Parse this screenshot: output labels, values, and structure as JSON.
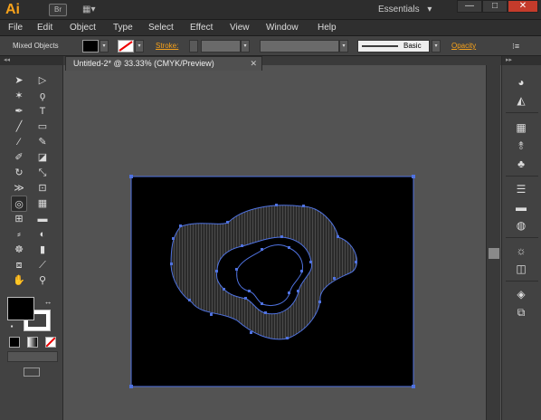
{
  "app": {
    "logo": "Ai",
    "bridge_label": "Br",
    "arrange_label": "▦▾",
    "workspace": "Essentials",
    "workspace_arrow": "▾",
    "window_controls": [
      "—",
      "□",
      "✕"
    ]
  },
  "menu": [
    "File",
    "Edit",
    "Object",
    "Type",
    "Select",
    "Effect",
    "View",
    "Window",
    "Help"
  ],
  "control_bar": {
    "selection": "Mixed Objects",
    "stroke_label": "Stroke:",
    "brush_label": "Basic",
    "opacity_label": "Opacity",
    "panel_menu": "⁝≡",
    "dropdown_arrow": "▾"
  },
  "document": {
    "tab_title": "Untitled-2* @ 33.33% (CMYK/Preview)",
    "close": "✕"
  },
  "tools": {
    "collapse": "◂◂",
    "icons": [
      "selection-icon",
      "direct-selection-icon",
      "magic-wand-icon",
      "lasso-icon",
      "pen-icon",
      "type-icon",
      "line-icon",
      "rectangle-icon",
      "paintbrush-icon",
      "pencil-icon",
      "blob-brush-icon",
      "eraser-icon",
      "rotate-icon",
      "scale-icon",
      "width-icon",
      "free-transform-icon",
      "shape-builder-icon",
      "perspective-grid-icon",
      "mesh-icon",
      "gradient-icon",
      "eyedropper-icon",
      "blend-icon",
      "symbol-sprayer-icon",
      "column-graph-icon",
      "artboard-icon",
      "slice-icon",
      "hand-icon",
      "zoom-icon"
    ]
  },
  "right_panel": {
    "collapse": "▸▸",
    "icons": [
      "color-icon",
      "color-guide-icon",
      "swatches-icon",
      "brushes-icon",
      "symbols-icon",
      "stroke-icon",
      "gradient-panel-icon",
      "transparency-icon",
      "appearance-icon",
      "graphic-styles-icon",
      "layers-icon",
      "artboards-icon"
    ]
  },
  "colors": {
    "accent": "#f7a21b",
    "path": "#4f72e0",
    "artboard": "#000000"
  }
}
